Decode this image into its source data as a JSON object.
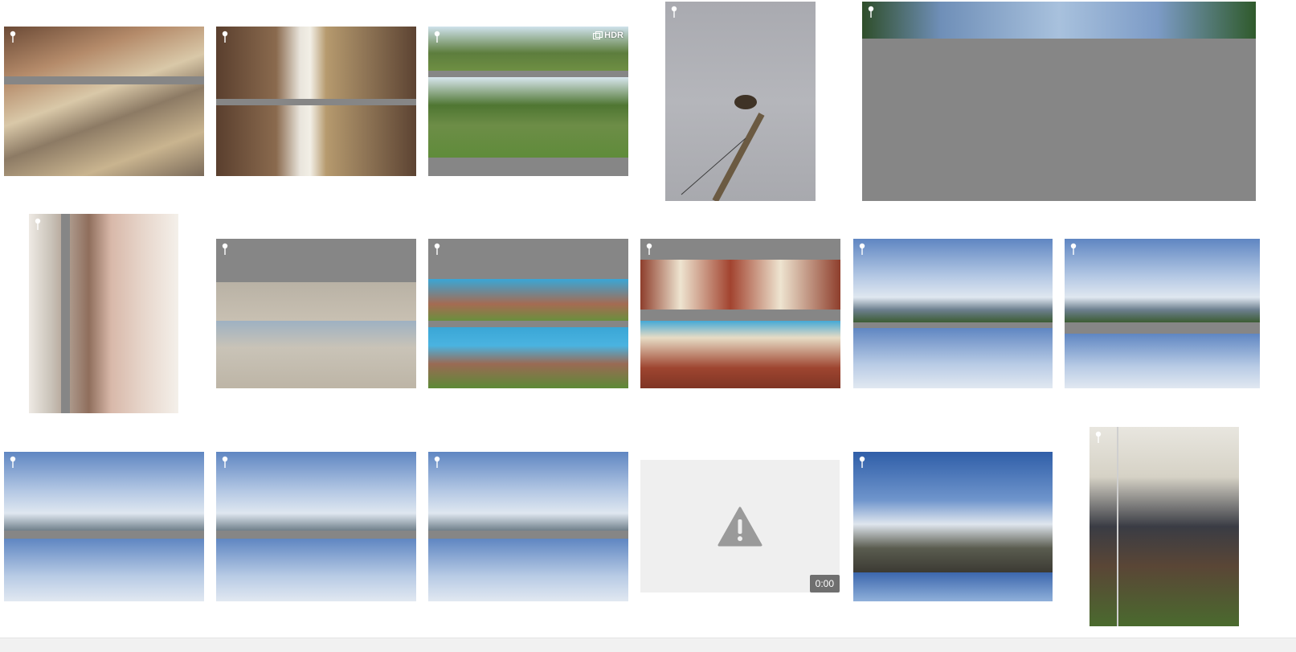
{
  "photos": [
    {
      "name": "photo-patio-gravel",
      "location_pin": true
    },
    {
      "name": "photo-room-interior",
      "location_pin": true
    },
    {
      "name": "photo-garden-lawn",
      "location_pin": true,
      "badge": "HDR"
    },
    {
      "name": "photo-bird-on-pole",
      "location_pin": true
    },
    {
      "name": "photo-palm-trees-sky",
      "location_pin": true
    },
    {
      "name": "photo-woman-and-child",
      "location_pin": true
    },
    {
      "name": "photo-beach-sand",
      "location_pin": true
    },
    {
      "name": "photo-pool-deck",
      "location_pin": true
    },
    {
      "name": "photo-pool-steps",
      "location_pin": true
    },
    {
      "name": "photo-seaside-palms-1",
      "location_pin": true
    },
    {
      "name": "photo-seaside-palms-2",
      "location_pin": true
    },
    {
      "name": "photo-seaside-palms-3",
      "location_pin": true
    },
    {
      "name": "photo-seaside-palms-4",
      "location_pin": true
    },
    {
      "name": "photo-seaside-palms-5",
      "location_pin": true
    },
    {
      "name": "video-unavailable",
      "location_pin": false,
      "duration": "0:00",
      "icon": "warning-icon"
    },
    {
      "name": "photo-mountain-clouds",
      "location_pin": true
    },
    {
      "name": "photo-wine-tent",
      "location_pin": true
    }
  ],
  "colors": {
    "placeholder_band": "#868686",
    "video_placeholder_bg": "#efefef",
    "warning_icon": "#9a9a9a"
  }
}
